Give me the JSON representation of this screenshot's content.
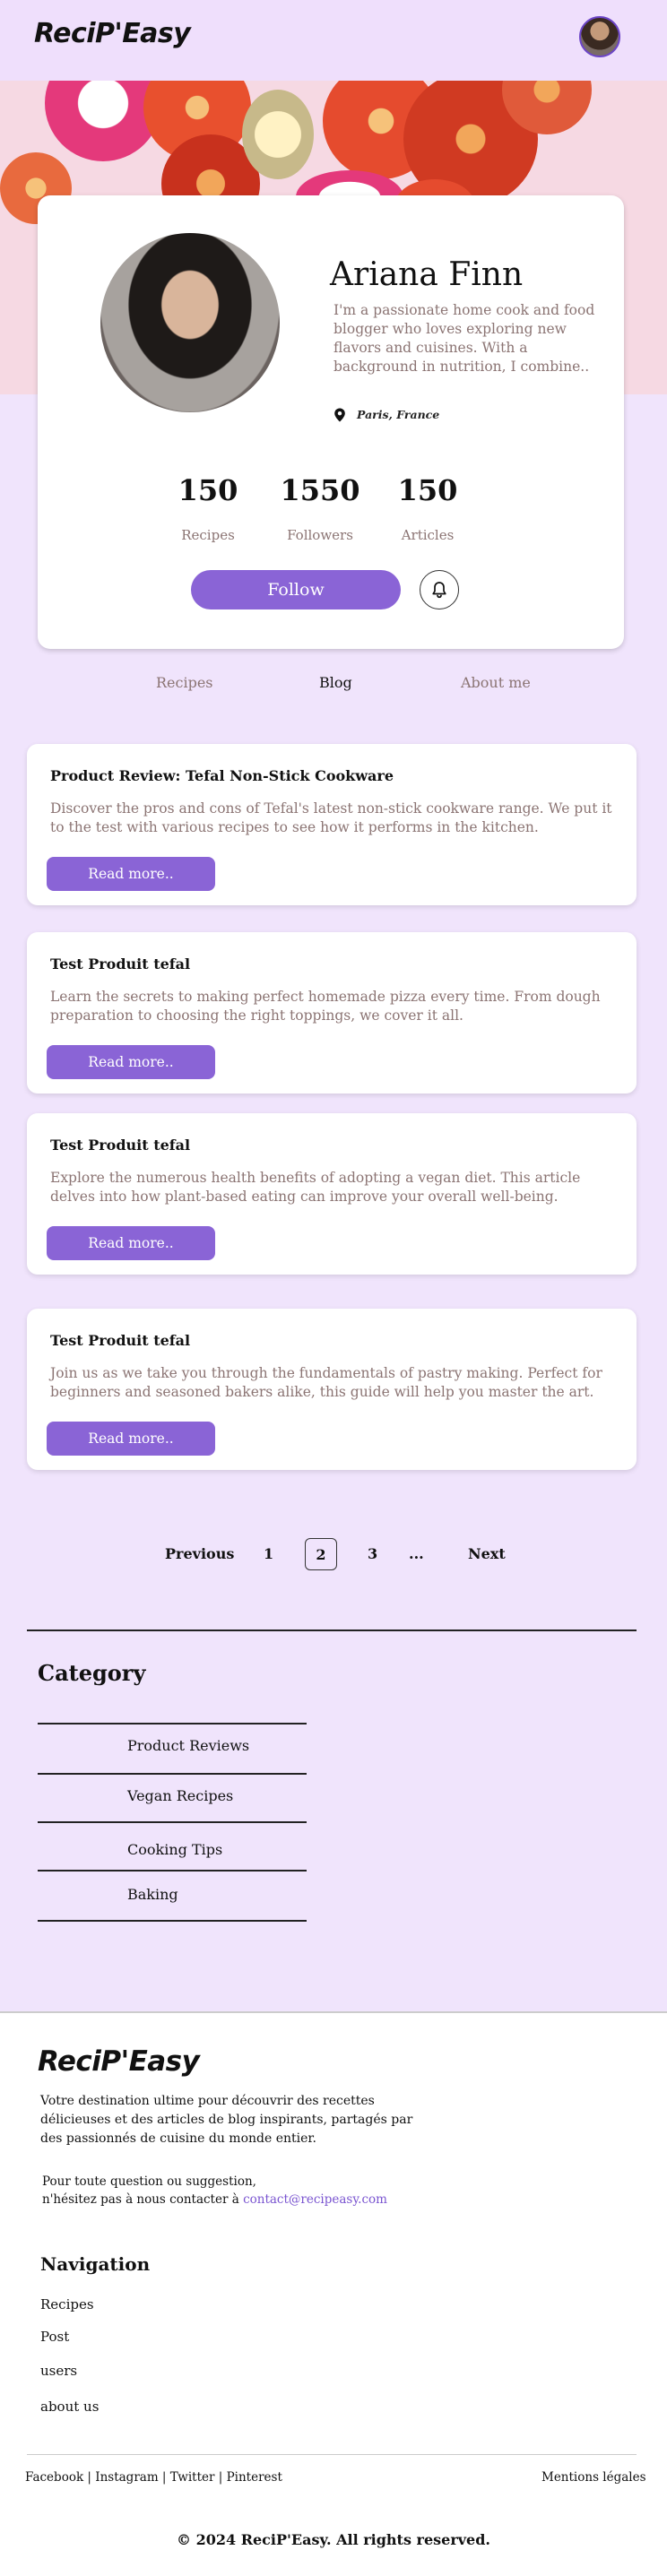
{
  "header": {
    "logo": "ReciP'Easy"
  },
  "profile": {
    "name": "Ariana Finn",
    "bio": "I'm a passionate home cook and food blogger who loves exploring new flavors and cuisines. With a background in nutrition, I combine..",
    "location": "Paris, France",
    "stats": [
      {
        "value": "150",
        "label": "Recipes"
      },
      {
        "value": "1550",
        "label": "Followers"
      },
      {
        "value": "150",
        "label": "Articles"
      }
    ],
    "follow_label": "Follow"
  },
  "tabs": [
    "Recipes",
    "Blog",
    "About me"
  ],
  "active_tab": "Blog",
  "articles": [
    {
      "title": "Product Review: Tefal Non-Stick Cookware",
      "description": "Discover the pros and cons of Tefal's latest non-stick cookware range. We put it to the test with various recipes to see how it performs in the kitchen.",
      "button": "Read more.."
    },
    {
      "title": "Test Produit tefal",
      "description": "Learn the secrets to making perfect homemade pizza every time. From dough preparation to choosing the right toppings, we cover it all.",
      "button": "Read more.."
    },
    {
      "title": "Test Produit tefal",
      "description": "Explore the numerous health benefits of adopting a vegan diet. This article delves into how plant-based eating can improve your overall well-being.",
      "button": "Read more.."
    },
    {
      "title": "Test Produit tefal",
      "description": "Join us as we take you through the fundamentals of pastry making. Perfect for beginners and seasoned bakers alike, this guide will help you master the art.",
      "button": "Read more.."
    }
  ],
  "pagination": {
    "previous": "Previous",
    "pages": [
      "1",
      "2",
      "3"
    ],
    "current": "2",
    "ellipsis": "...",
    "next": "Next"
  },
  "category": {
    "title": "Category",
    "items": [
      "Product Reviews",
      "Vegan Recipes",
      "Cooking Tips",
      "Baking"
    ]
  },
  "footer": {
    "logo": "ReciP'Easy",
    "description": "Votre destination ultime pour découvrir des recettes délicieuses et des articles de blog inspirants, partagés par des passionnés de cuisine du monde entier.",
    "contact_line1": "Pour toute question ou suggestion,",
    "contact_line2": "n'hésitez pas à nous contacter à ",
    "contact_email": "contact@recipeasy.com",
    "nav_title": "Navigation",
    "nav_items": [
      "Recipes",
      "Post",
      "users",
      "about us"
    ],
    "social": "Facebook | Instagram | Twitter | Pinterest",
    "legal": "Mentions légales",
    "copyright": "© 2024 ReciP'Easy. All rights reserved."
  },
  "colors": {
    "accent": "#8a64d6",
    "background": "#f0e4fc",
    "muted_text": "#8b7473"
  }
}
